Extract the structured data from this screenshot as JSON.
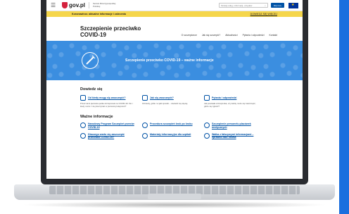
{
  "header": {
    "logo": "gov.pl",
    "service": "Serwis Rzeczypospolitej Polskiej",
    "search_placeholder": "Szukaj usług, informacji, urzędów",
    "login": "Mój Gov"
  },
  "alert": {
    "text": "Koronawirus: aktualne informacje i zalecenia",
    "link": "DOWIEDZ SIĘ WIĘCEJ"
  },
  "page": {
    "title": "Szczepienie przeciwko COVID-19",
    "nav": [
      "O szczepionce",
      "Jak się szczepić?",
      "Aktualności",
      "Pytania i odpowiedzi",
      "Kontakt"
    ]
  },
  "hero": {
    "title": "Szczepienie przeciwko COVID-19 – ważne informacje"
  },
  "learn": {
    "title": "Dowiedz się",
    "cards": [
      {
        "title": "Od kiedy mogę się zaszczepić?",
        "text": "Przed nami pierwsza partia szczepionek na COVID-19. Kto i kiedy może z niej skorzystać w pierwszej kolejności?"
      },
      {
        "title": "Jak się zaszczepić?",
        "text": "Od kiedy, gdzie i w jaki sposób – dowiedz się więcej."
      },
      {
        "title": "Pytania i odpowiedzi",
        "text": "Jak powstała szczepionka, czy każdy może się zaszczepić, gdzie się zgłosić?"
      }
    ]
  },
  "important": {
    "title": "Ważne informacje",
    "items": [
      "Narodowy Program Szczepień przeciw COVID-19",
      "Procedura szczepień krok po kroku",
      "Szczepienie personelu placówek medycznych",
      "Dlaczego warto się zaszczepić przeciwko COVID-19?",
      "Materiały informacyjne dla szpitali",
      "Walka z fałszywymi informacjami – sprawdź fake newsa"
    ]
  },
  "colors": {
    "accent": "#0052a5",
    "alert": "#f5d64b",
    "hero": "#3b8ee0",
    "strip": "#1b6fde"
  }
}
